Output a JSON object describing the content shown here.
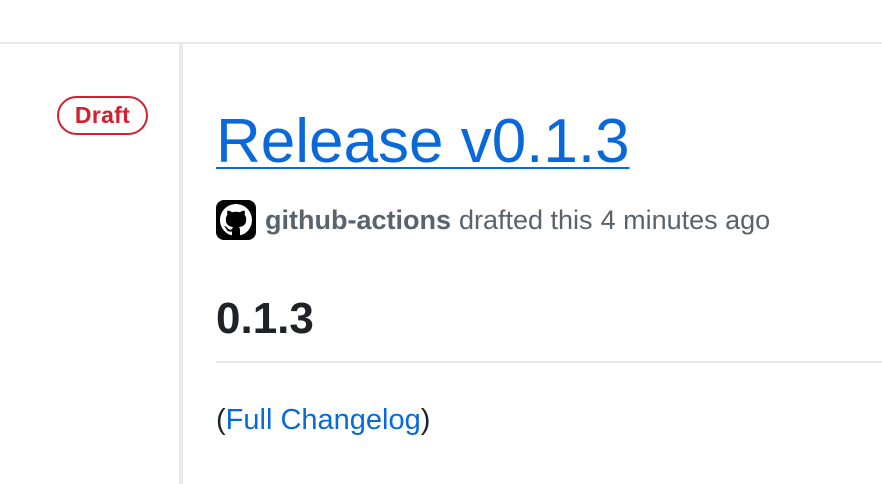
{
  "release": {
    "status_badge": "Draft",
    "title": "Release v0.1.3",
    "author": "github-actions",
    "action_text": "drafted this",
    "time_ago": "4 minutes ago",
    "avatar_icon": "github-mark-icon"
  },
  "body": {
    "version_heading": "0.1.3",
    "open_paren": "(",
    "changelog_link": "Full Changelog",
    "close_paren": ")"
  },
  "colors": {
    "link": "#0969da",
    "draft": "#cf222e",
    "muted": "#59636e",
    "text": "#1f2328",
    "border": "#e7e9ec"
  }
}
